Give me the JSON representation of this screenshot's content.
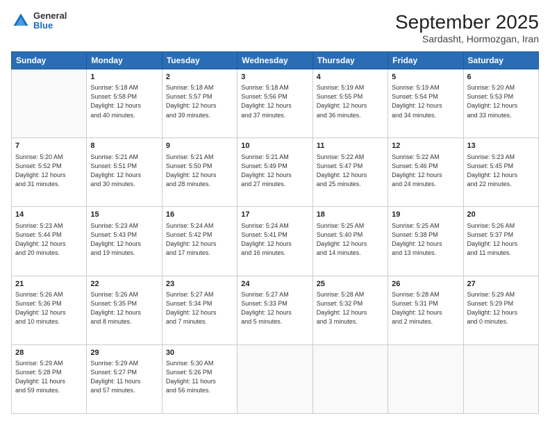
{
  "header": {
    "logo": {
      "general": "General",
      "blue": "Blue"
    },
    "title": "September 2025",
    "subtitle": "Sardasht, Hormozgan, Iran"
  },
  "weekdays": [
    "Sunday",
    "Monday",
    "Tuesday",
    "Wednesday",
    "Thursday",
    "Friday",
    "Saturday"
  ],
  "weeks": [
    [
      {
        "day": null,
        "info": null
      },
      {
        "day": "1",
        "info": "Sunrise: 5:18 AM\nSunset: 5:58 PM\nDaylight: 12 hours\nand 40 minutes."
      },
      {
        "day": "2",
        "info": "Sunrise: 5:18 AM\nSunset: 5:57 PM\nDaylight: 12 hours\nand 39 minutes."
      },
      {
        "day": "3",
        "info": "Sunrise: 5:18 AM\nSunset: 5:56 PM\nDaylight: 12 hours\nand 37 minutes."
      },
      {
        "day": "4",
        "info": "Sunrise: 5:19 AM\nSunset: 5:55 PM\nDaylight: 12 hours\nand 36 minutes."
      },
      {
        "day": "5",
        "info": "Sunrise: 5:19 AM\nSunset: 5:54 PM\nDaylight: 12 hours\nand 34 minutes."
      },
      {
        "day": "6",
        "info": "Sunrise: 5:20 AM\nSunset: 5:53 PM\nDaylight: 12 hours\nand 33 minutes."
      }
    ],
    [
      {
        "day": "7",
        "info": "Sunrise: 5:20 AM\nSunset: 5:52 PM\nDaylight: 12 hours\nand 31 minutes."
      },
      {
        "day": "8",
        "info": "Sunrise: 5:21 AM\nSunset: 5:51 PM\nDaylight: 12 hours\nand 30 minutes."
      },
      {
        "day": "9",
        "info": "Sunrise: 5:21 AM\nSunset: 5:50 PM\nDaylight: 12 hours\nand 28 minutes."
      },
      {
        "day": "10",
        "info": "Sunrise: 5:21 AM\nSunset: 5:49 PM\nDaylight: 12 hours\nand 27 minutes."
      },
      {
        "day": "11",
        "info": "Sunrise: 5:22 AM\nSunset: 5:47 PM\nDaylight: 12 hours\nand 25 minutes."
      },
      {
        "day": "12",
        "info": "Sunrise: 5:22 AM\nSunset: 5:46 PM\nDaylight: 12 hours\nand 24 minutes."
      },
      {
        "day": "13",
        "info": "Sunrise: 5:23 AM\nSunset: 5:45 PM\nDaylight: 12 hours\nand 22 minutes."
      }
    ],
    [
      {
        "day": "14",
        "info": "Sunrise: 5:23 AM\nSunset: 5:44 PM\nDaylight: 12 hours\nand 20 minutes."
      },
      {
        "day": "15",
        "info": "Sunrise: 5:23 AM\nSunset: 5:43 PM\nDaylight: 12 hours\nand 19 minutes."
      },
      {
        "day": "16",
        "info": "Sunrise: 5:24 AM\nSunset: 5:42 PM\nDaylight: 12 hours\nand 17 minutes."
      },
      {
        "day": "17",
        "info": "Sunrise: 5:24 AM\nSunset: 5:41 PM\nDaylight: 12 hours\nand 16 minutes."
      },
      {
        "day": "18",
        "info": "Sunrise: 5:25 AM\nSunset: 5:40 PM\nDaylight: 12 hours\nand 14 minutes."
      },
      {
        "day": "19",
        "info": "Sunrise: 5:25 AM\nSunset: 5:38 PM\nDaylight: 12 hours\nand 13 minutes."
      },
      {
        "day": "20",
        "info": "Sunrise: 5:26 AM\nSunset: 5:37 PM\nDaylight: 12 hours\nand 11 minutes."
      }
    ],
    [
      {
        "day": "21",
        "info": "Sunrise: 5:26 AM\nSunset: 5:36 PM\nDaylight: 12 hours\nand 10 minutes."
      },
      {
        "day": "22",
        "info": "Sunrise: 5:26 AM\nSunset: 5:35 PM\nDaylight: 12 hours\nand 8 minutes."
      },
      {
        "day": "23",
        "info": "Sunrise: 5:27 AM\nSunset: 5:34 PM\nDaylight: 12 hours\nand 7 minutes."
      },
      {
        "day": "24",
        "info": "Sunrise: 5:27 AM\nSunset: 5:33 PM\nDaylight: 12 hours\nand 5 minutes."
      },
      {
        "day": "25",
        "info": "Sunrise: 5:28 AM\nSunset: 5:32 PM\nDaylight: 12 hours\nand 3 minutes."
      },
      {
        "day": "26",
        "info": "Sunrise: 5:28 AM\nSunset: 5:31 PM\nDaylight: 12 hours\nand 2 minutes."
      },
      {
        "day": "27",
        "info": "Sunrise: 5:29 AM\nSunset: 5:29 PM\nDaylight: 12 hours\nand 0 minutes."
      }
    ],
    [
      {
        "day": "28",
        "info": "Sunrise: 5:29 AM\nSunset: 5:28 PM\nDaylight: 11 hours\nand 59 minutes."
      },
      {
        "day": "29",
        "info": "Sunrise: 5:29 AM\nSunset: 5:27 PM\nDaylight: 11 hours\nand 57 minutes."
      },
      {
        "day": "30",
        "info": "Sunrise: 5:30 AM\nSunset: 5:26 PM\nDaylight: 11 hours\nand 56 minutes."
      },
      {
        "day": null,
        "info": null
      },
      {
        "day": null,
        "info": null
      },
      {
        "day": null,
        "info": null
      },
      {
        "day": null,
        "info": null
      }
    ]
  ]
}
